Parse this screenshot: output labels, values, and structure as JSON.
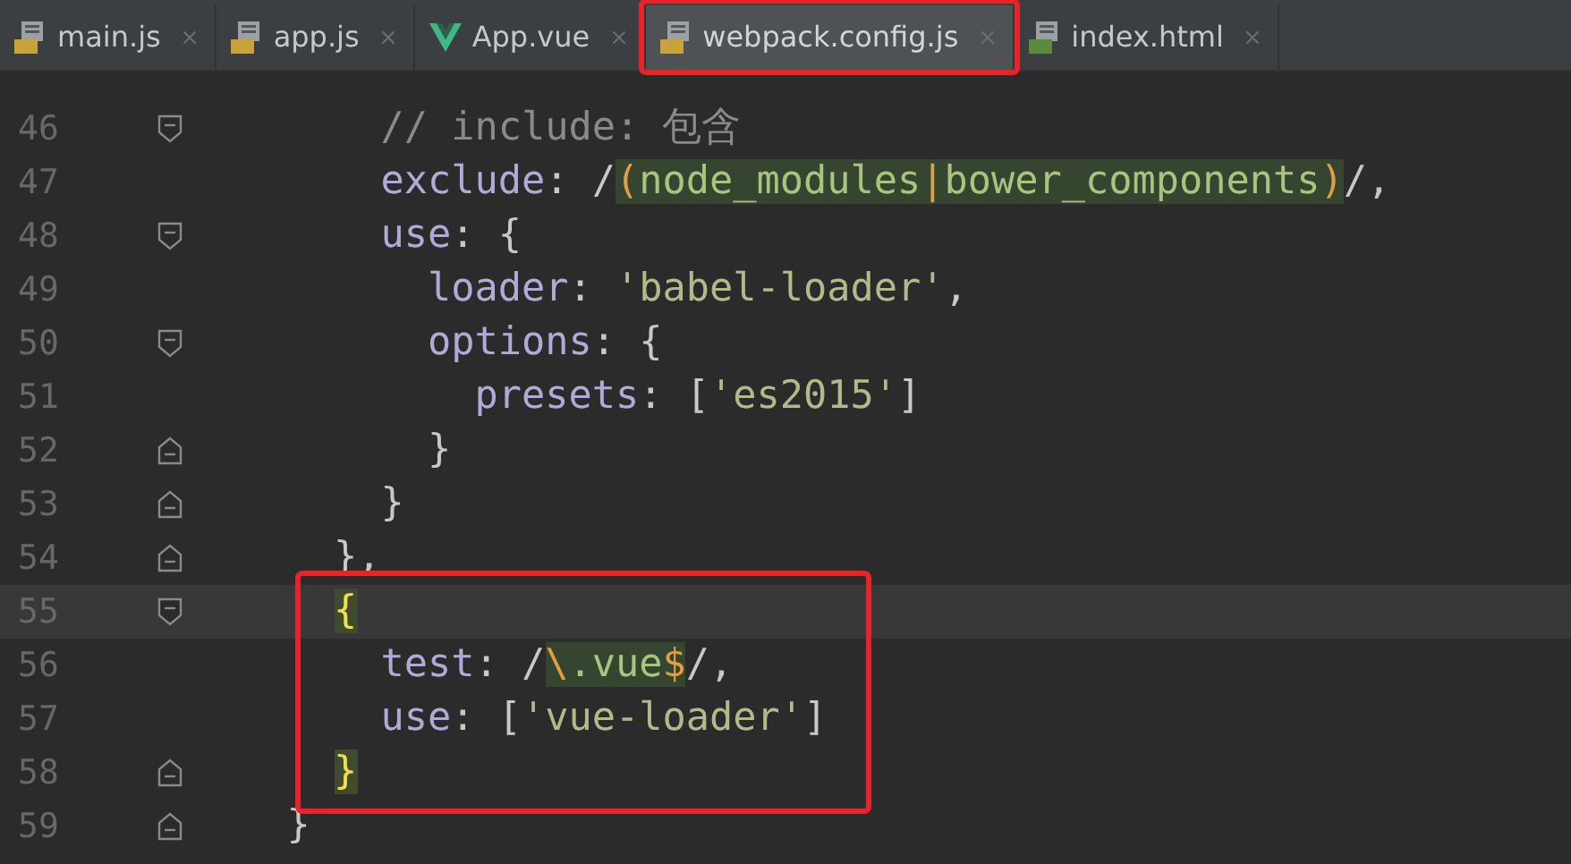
{
  "tabs": [
    {
      "label": "main.js",
      "kind": "js",
      "selected": false,
      "annotated": false
    },
    {
      "label": "app.js",
      "kind": "js",
      "selected": false,
      "annotated": false
    },
    {
      "label": "App.vue",
      "kind": "vue",
      "selected": false,
      "annotated": false
    },
    {
      "label": "webpack.config.js",
      "kind": "js",
      "selected": true,
      "annotated": true
    },
    {
      "label": "index.html",
      "kind": "html",
      "selected": false,
      "annotated": false
    }
  ],
  "blocks": [
    {
      "annotated": false,
      "lines": [
        {
          "number": "46",
          "kind": "fold-open",
          "current": false,
          "tokens": [
            {
              "kind": "comment",
              "text": "      // include: 包含"
            }
          ]
        },
        {
          "number": "47",
          "kind": "plain",
          "current": false,
          "tokens": [
            {
              "kind": "key",
              "text": "      exclude"
            },
            {
              "kind": "punct",
              "text": ": /"
            },
            {
              "kind": "regex-meta",
              "text": "("
            },
            {
              "kind": "regex",
              "text": "node_modules"
            },
            {
              "kind": "regex-meta",
              "text": "|"
            },
            {
              "kind": "regex",
              "text": "bower_components"
            },
            {
              "kind": "regex-meta",
              "text": ")"
            },
            {
              "kind": "punct",
              "text": "/,"
            }
          ]
        },
        {
          "number": "48",
          "kind": "fold-open",
          "current": false,
          "tokens": [
            {
              "kind": "key",
              "text": "      use"
            },
            {
              "kind": "punct",
              "text": ": {"
            }
          ]
        },
        {
          "number": "49",
          "kind": "plain",
          "current": false,
          "tokens": [
            {
              "kind": "key",
              "text": "        loader"
            },
            {
              "kind": "punct",
              "text": ": "
            },
            {
              "kind": "string",
              "text": "'babel-loader'"
            },
            {
              "kind": "punct",
              "text": ","
            }
          ]
        },
        {
          "number": "50",
          "kind": "fold-open",
          "current": false,
          "tokens": [
            {
              "kind": "key",
              "text": "        options"
            },
            {
              "kind": "punct",
              "text": ": {"
            }
          ]
        },
        {
          "number": "51",
          "kind": "plain",
          "current": false,
          "tokens": [
            {
              "kind": "key",
              "text": "          presets"
            },
            {
              "kind": "punct",
              "text": ": ["
            },
            {
              "kind": "string",
              "text": "'es2015'"
            },
            {
              "kind": "punct",
              "text": "]"
            }
          ]
        },
        {
          "number": "52",
          "kind": "fold-close",
          "current": false,
          "tokens": [
            {
              "kind": "punct",
              "text": "        }"
            }
          ]
        },
        {
          "number": "53",
          "kind": "fold-close",
          "current": false,
          "tokens": [
            {
              "kind": "punct",
              "text": "      }"
            }
          ]
        },
        {
          "number": "54",
          "kind": "fold-close",
          "current": false,
          "tokens": [
            {
              "kind": "punct",
              "text": "    },"
            }
          ]
        }
      ]
    },
    {
      "annotated": true,
      "lines": [
        {
          "number": "55",
          "kind": "fold-open",
          "current": true,
          "tokens": [
            {
              "kind": "brace-match",
              "text": "    {"
            }
          ]
        },
        {
          "number": "56",
          "kind": "plain",
          "current": false,
          "tokens": [
            {
              "kind": "key",
              "text": "      test"
            },
            {
              "kind": "punct",
              "text": ": /"
            },
            {
              "kind": "regex-meta",
              "text": "\\"
            },
            {
              "kind": "regex",
              "text": ".vue"
            },
            {
              "kind": "regex-meta",
              "text": "$"
            },
            {
              "kind": "punct",
              "text": "/,"
            }
          ]
        },
        {
          "number": "57",
          "kind": "plain",
          "current": false,
          "tokens": [
            {
              "kind": "key",
              "text": "      use"
            },
            {
              "kind": "punct",
              "text": ": ["
            },
            {
              "kind": "string",
              "text": "'vue-loader'"
            },
            {
              "kind": "punct",
              "text": "]"
            }
          ]
        },
        {
          "number": "58",
          "kind": "fold-close",
          "current": false,
          "tokens": [
            {
              "kind": "brace-match",
              "text": "    }"
            }
          ]
        }
      ]
    },
    {
      "annotated": false,
      "lines": [
        {
          "number": "59",
          "kind": "fold-close",
          "current": false,
          "tokens": [
            {
              "kind": "punct",
              "text": "  }"
            }
          ]
        }
      ]
    }
  ]
}
